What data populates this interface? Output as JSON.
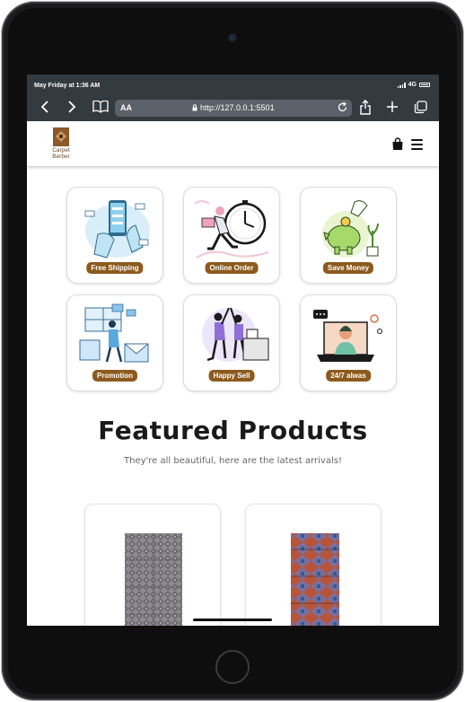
{
  "status_bar": {
    "time": "May Friday at 1:36 AM",
    "network": "4G"
  },
  "browser": {
    "aa_label": "AA",
    "url": "http://127.0.0.1:5501"
  },
  "header": {
    "logo_line1": "Carpet",
    "logo_line2": "Berber"
  },
  "features": [
    {
      "label": "Free Shipping"
    },
    {
      "label": "Online Order"
    },
    {
      "label": "Save Money"
    },
    {
      "label": "Promotion"
    },
    {
      "label": "Happy Sell"
    },
    {
      "label": "24/7 alwas"
    }
  ],
  "featured": {
    "title": "Featured Products",
    "subtitle": "They're all beautiful, here are the latest arrivals!"
  },
  "colors": {
    "accent": "#8c5a1d",
    "browser_chrome": "#333a40"
  }
}
